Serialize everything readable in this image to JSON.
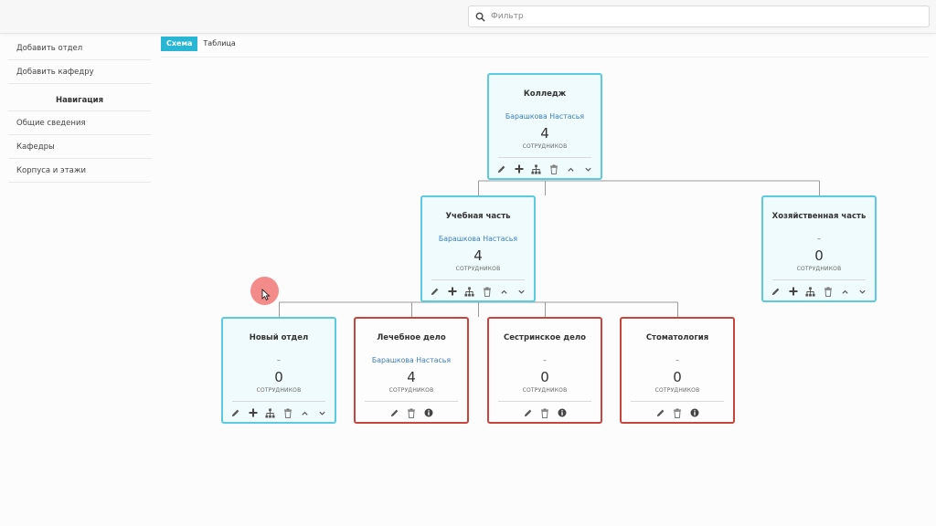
{
  "search": {
    "placeholder": "Фильтр"
  },
  "sidebar": {
    "actions": [
      "Добавить отдел",
      "Добавить кафедру"
    ],
    "nav_title": "Навигация",
    "nav": [
      "Общие сведения",
      "Кафедры",
      "Корпуса и этажи"
    ]
  },
  "tabs": [
    "Схема",
    "Таблица"
  ],
  "staff_caption": "СОТРУДНИКОВ",
  "colors": {
    "accent": "#29b6d4",
    "card_border": "#5ccbdf",
    "inactive_border": "#c8453e",
    "head_link": "#3d7fb8"
  },
  "cards": [
    {
      "title": "Колледж",
      "head": "Барашкова Настасья",
      "count": "4"
    },
    {
      "title": "Учебная часть",
      "head": "Барашкова Настасья",
      "count": "4"
    },
    {
      "title": "Хозяйственная часть",
      "head": "–",
      "count": "0"
    },
    {
      "title": "Новый отдел",
      "head": "–",
      "count": "0"
    },
    {
      "title": "Лечебное дело",
      "head": "Барашкова Настасья",
      "count": "4"
    },
    {
      "title": "Сестринское дело",
      "head": "–",
      "count": "0"
    },
    {
      "title": "Стоматология",
      "head": "–",
      "count": "0"
    }
  ]
}
